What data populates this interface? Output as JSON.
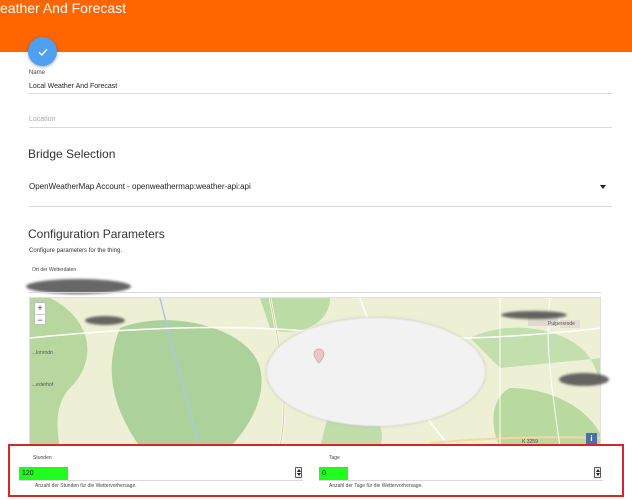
{
  "header": {
    "title": "eather And Forecast"
  },
  "actions": {
    "save_icon": "check-icon"
  },
  "form": {
    "name": {
      "label": "Name",
      "value": "Local Weather And Forecast"
    },
    "location": {
      "placeholder": "Location"
    },
    "bridge": {
      "title": "Bridge Selection",
      "selected": "OpenWeatherMap Account - openweathermap:weather-api:api"
    },
    "config": {
      "title": "Configuration Parameters",
      "description": "Configure parameters for the thing.",
      "location_label": "Ort der Wetterdaten"
    }
  },
  "map": {
    "zoom_in": "+",
    "zoom_out": "−",
    "road_label": "K 3259",
    "info_label": "i",
    "place_labels": [
      "Pulpersrode",
      "...lonrodn",
      "...ederhof"
    ]
  },
  "params": {
    "hours": {
      "label": "Stunden",
      "value": "120",
      "hint": "Anzahl der Stunden für die Wettervorhersage."
    },
    "days": {
      "label": "Tage",
      "value": "0",
      "hint": "Anzahl der Tage für die Wettervorhersage."
    }
  },
  "colors": {
    "header": "#ff6600",
    "fab": "#4f9ff1",
    "highlight": "#1eff1e",
    "annotation": "#d6262b"
  }
}
